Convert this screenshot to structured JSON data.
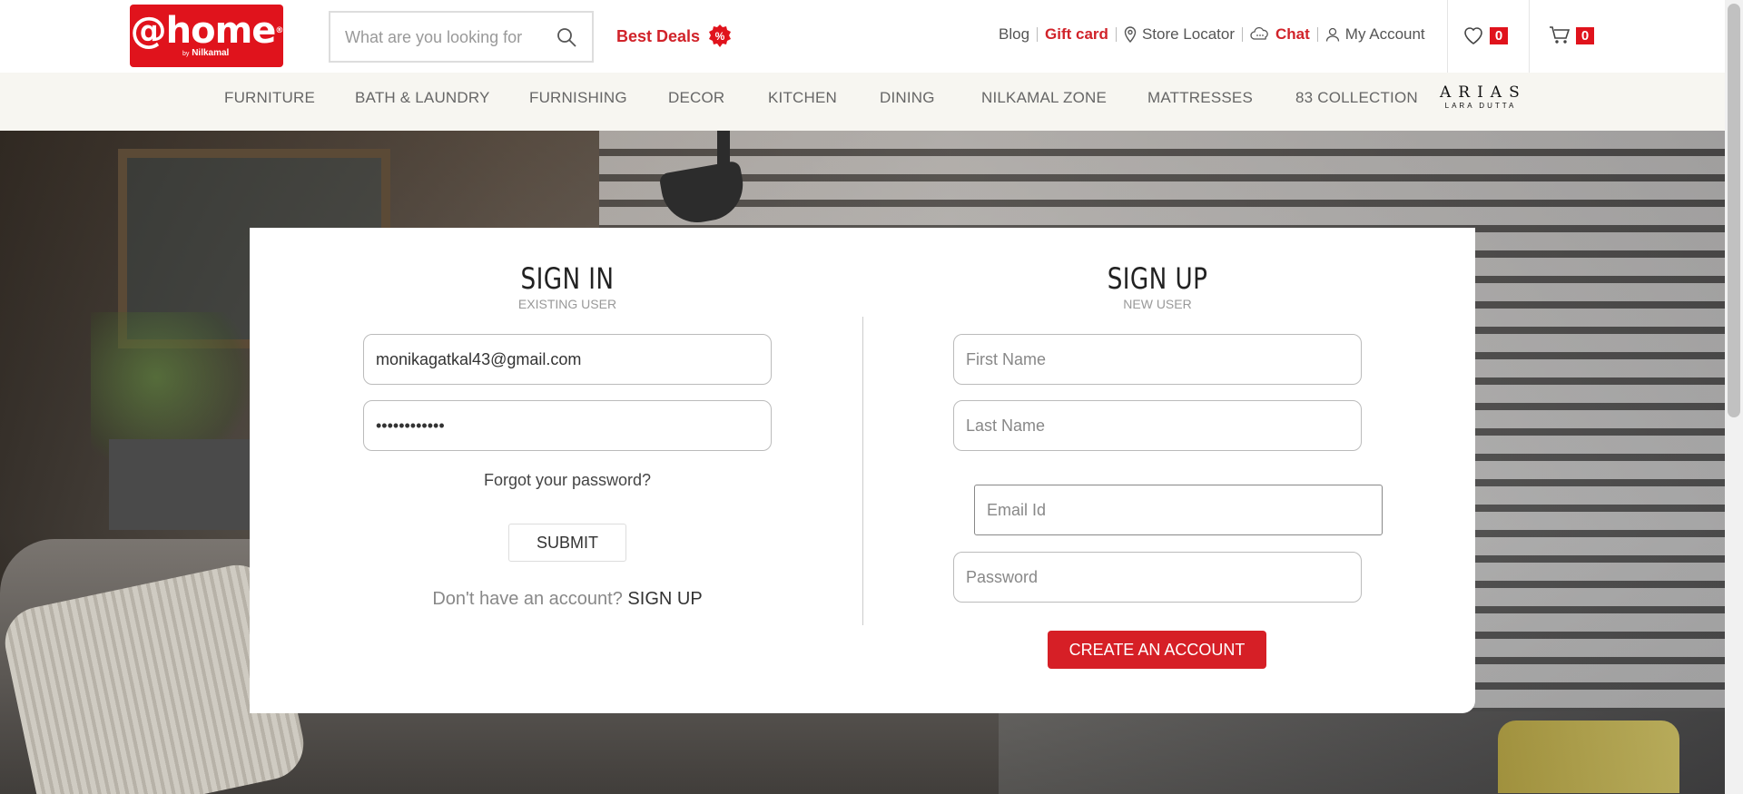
{
  "header": {
    "logo": {
      "main": "@home",
      "by": "by",
      "brand": "Nilkamal"
    },
    "search_placeholder": "What are you looking for",
    "best_deals": "Best Deals",
    "links": {
      "blog": "Blog",
      "gift_card": "Gift card",
      "store_locator": "Store Locator",
      "chat": "Chat",
      "my_account": "My Account"
    },
    "wishlist_count": "0",
    "cart_count": "0"
  },
  "nav": {
    "items": [
      "FURNITURE",
      "BATH & LAUNDRY",
      "FURNISHING",
      "DECOR",
      "KITCHEN",
      "DINING",
      "NILKAMAL ZONE",
      "MATTRESSES",
      "83 COLLECTION"
    ],
    "arias": {
      "line1": "ARIAS",
      "line2": "LARA DUTTA"
    }
  },
  "signin": {
    "title": "SIGN IN",
    "subtitle": "EXISTING USER",
    "email_value": "monikagatkal43@gmail.com",
    "password_value": "monika@12345",
    "forgot": "Forgot your password?",
    "submit": "SUBMIT",
    "no_account": "Don't have an account?",
    "signup_link": "SIGN UP"
  },
  "signup": {
    "title": "SIGN UP",
    "subtitle": "NEW USER",
    "first_name_placeholder": "First Name",
    "last_name_placeholder": "Last Name",
    "email_placeholder": "Email Id",
    "password_placeholder": "Password",
    "create_button": "CREATE AN ACCOUNT"
  },
  "colors": {
    "brand_red": "#e0131c",
    "nav_bg": "#f7f6f1"
  }
}
